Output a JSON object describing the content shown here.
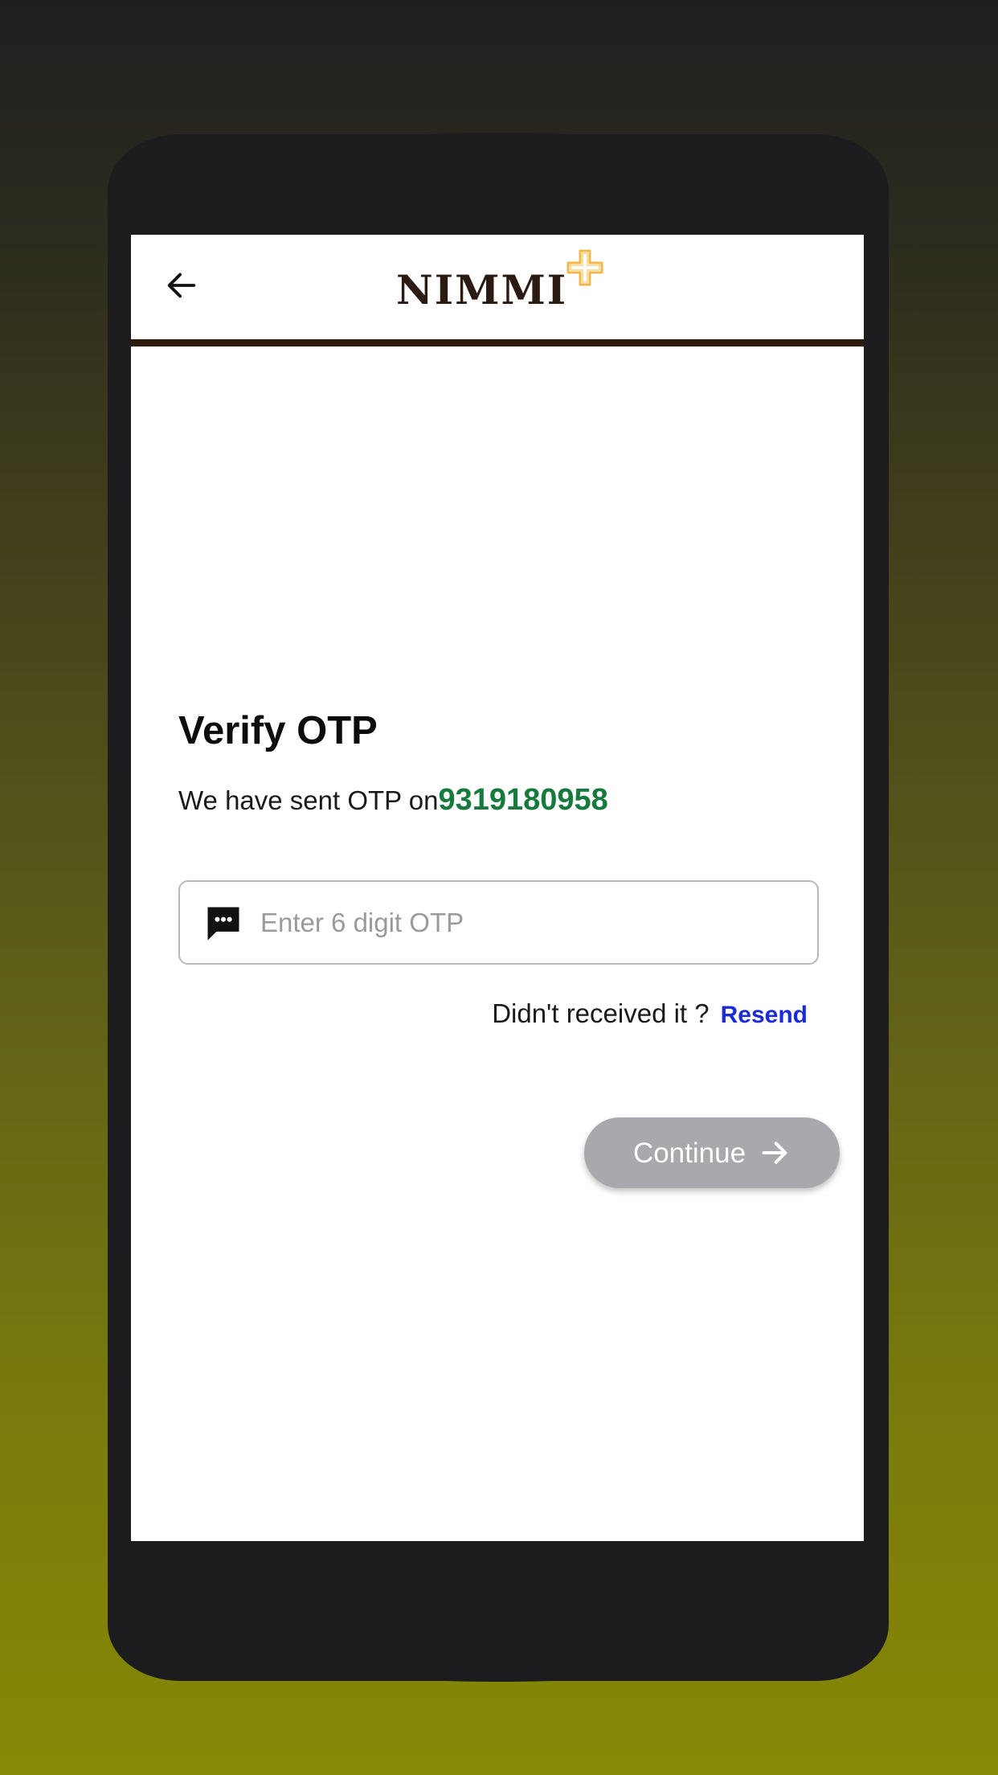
{
  "header": {
    "back_icon": "arrow-left-icon",
    "logo_text": "NIMMI",
    "logo_mark": "plus-outline-icon"
  },
  "verify": {
    "title": "Verify OTP",
    "sent_prefix": "We have sent OTP on",
    "phone_number": "9319180958"
  },
  "otp_field": {
    "icon": "message-dots-icon",
    "placeholder": "Enter 6 digit OTP",
    "value": ""
  },
  "resend": {
    "question": "Didn't received it ?",
    "link_label": "Resend"
  },
  "continue_button": {
    "label": "Continue",
    "icon": "arrow-right-icon",
    "state": "disabled"
  },
  "colors": {
    "header_rule": "#2c1a0c",
    "phone_number": "#157a3c",
    "resend_link": "#1a2bd9",
    "button_disabled": "#a9a8ad",
    "logo_text": "#2b1a12",
    "logo_mark": "#f0b84a"
  }
}
